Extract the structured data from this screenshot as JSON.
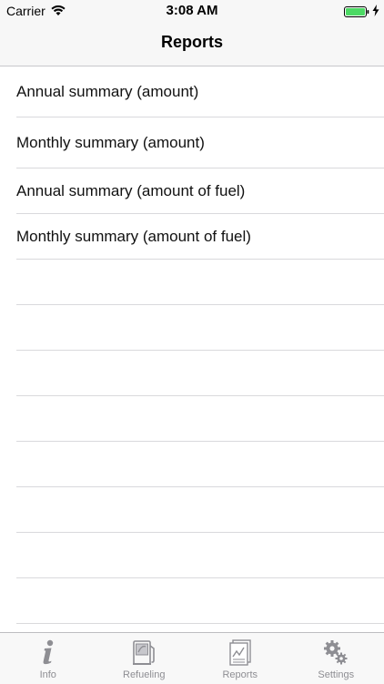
{
  "status_bar": {
    "carrier": "Carrier",
    "time": "3:08 AM",
    "battery_color": "#4cd964"
  },
  "nav": {
    "title": "Reports"
  },
  "list": {
    "items": [
      {
        "label": "Annual summary (amount)"
      },
      {
        "label": "Monthly summary (amount)"
      },
      {
        "label": "Annual summary (amount of fuel)"
      },
      {
        "label": "Monthly summary (amount of fuel)"
      }
    ]
  },
  "tab_bar": {
    "tabs": [
      {
        "label": "Info",
        "icon": "info-icon"
      },
      {
        "label": "Refueling",
        "icon": "fuel-pump-icon"
      },
      {
        "label": "Reports",
        "icon": "reports-icon"
      },
      {
        "label": "Settings",
        "icon": "gears-icon"
      }
    ]
  }
}
